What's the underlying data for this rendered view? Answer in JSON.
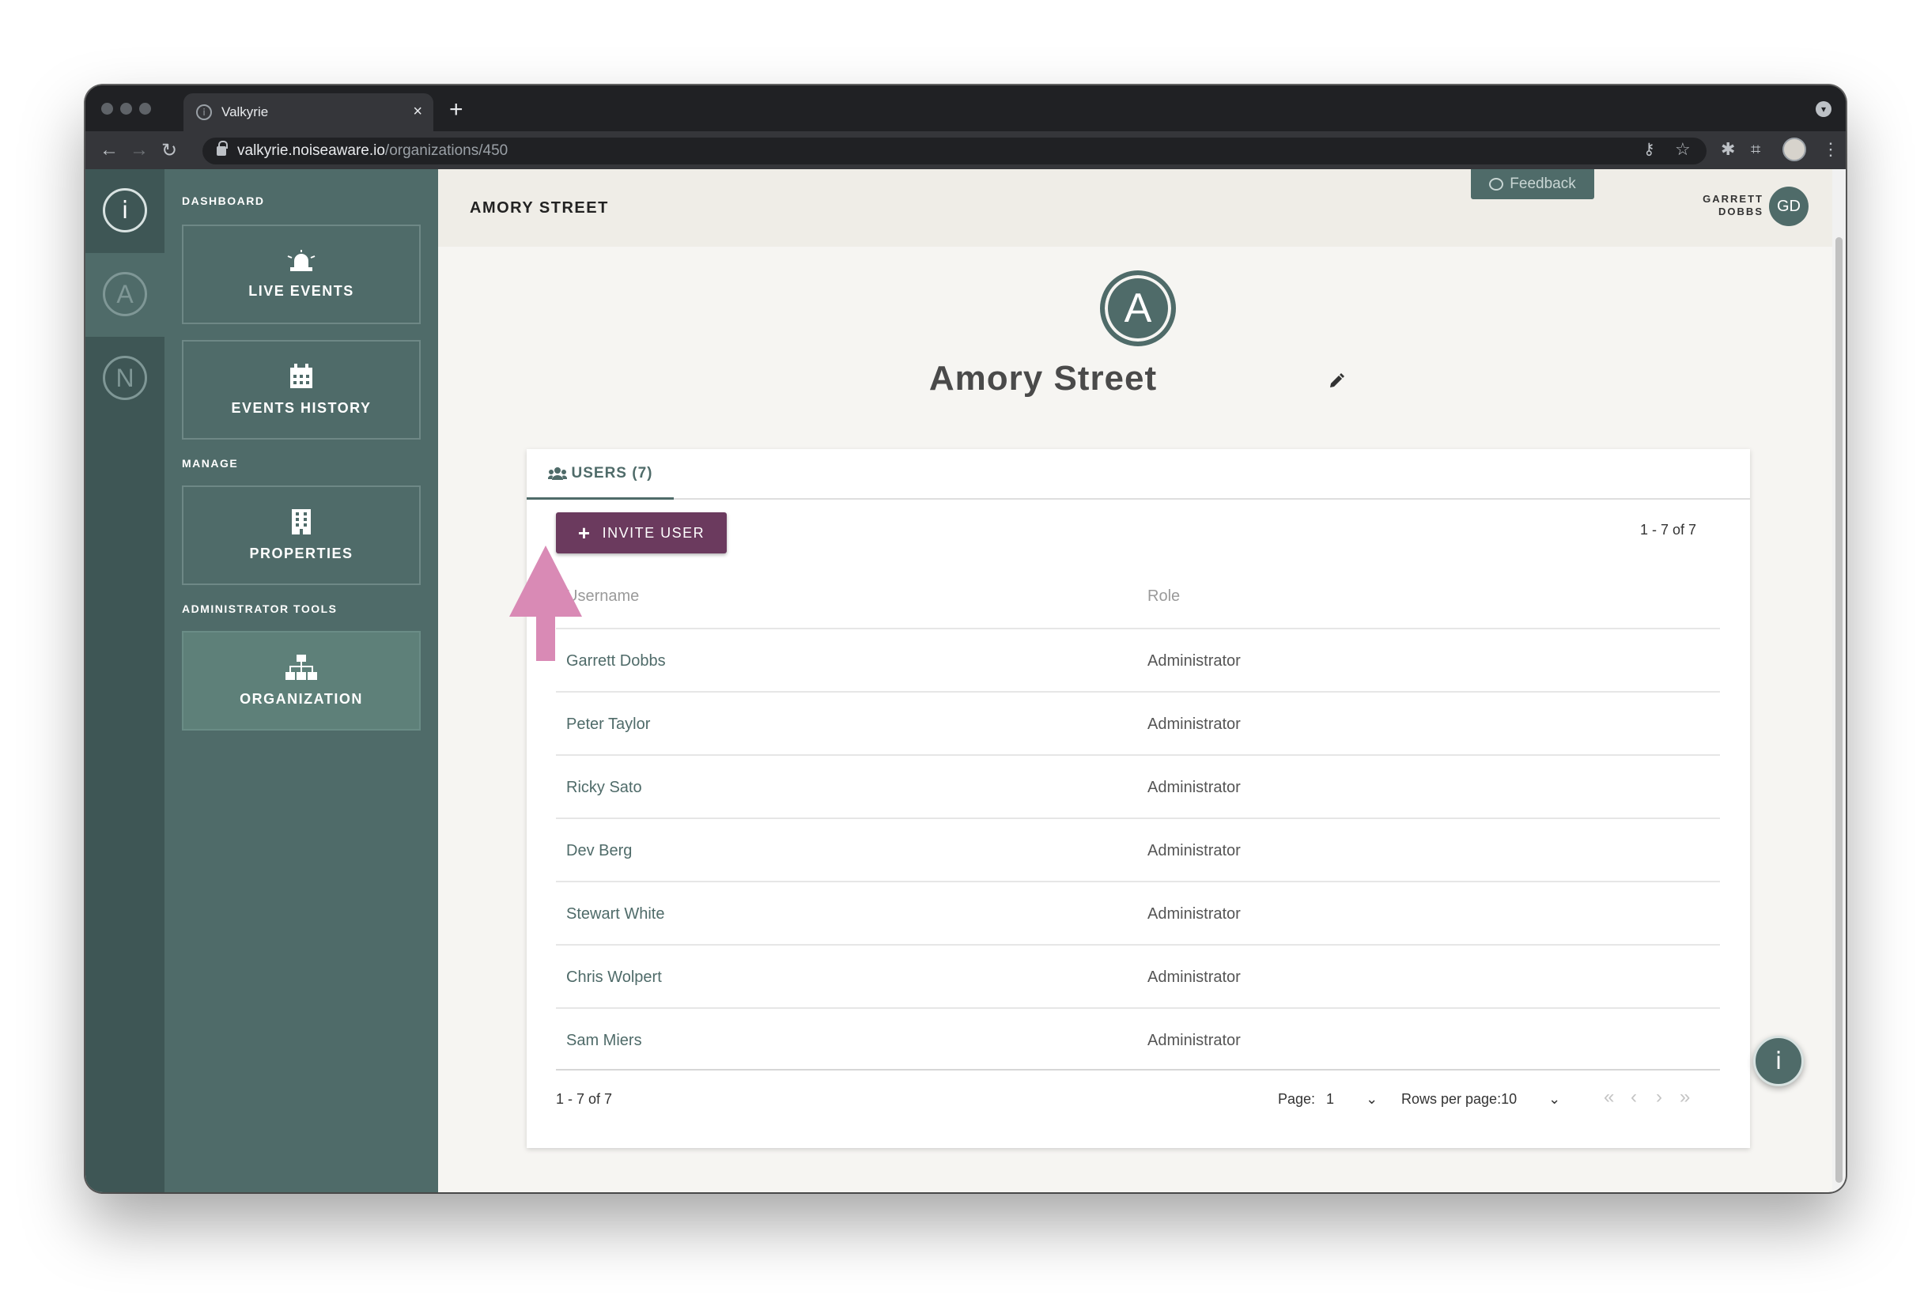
{
  "browser": {
    "tab_title": "Valkyrie",
    "tab_close": "×",
    "new_tab": "+",
    "url_host": "valkyrie.noiseaware.io",
    "url_path": "/organizations/450"
  },
  "rail": {
    "orgs": [
      "A",
      "N"
    ]
  },
  "sidebar": {
    "dashboard_label": "DASHBOARD",
    "live_events": "LIVE EVENTS",
    "events_history": "EVENTS HISTORY",
    "manage_label": "MANAGE",
    "properties": "PROPERTIES",
    "admin_label": "ADMINISTRATOR TOOLS",
    "organization": "ORGANIZATION"
  },
  "header": {
    "title": "AMORY STREET",
    "feedback": "Feedback",
    "user_first": "GARRETT",
    "user_last": "DOBBS",
    "user_initials": "GD"
  },
  "org": {
    "initial": "A",
    "name": "Amory Street"
  },
  "users_tab": {
    "label": "USERS (7)",
    "invite_button": "INVITE USER",
    "count_top": "1 - 7 of 7",
    "columns": {
      "username": "Username",
      "role": "Role"
    },
    "rows": [
      {
        "user": "Garrett Dobbs",
        "role": "Administrator"
      },
      {
        "user": "Peter Taylor",
        "role": "Administrator"
      },
      {
        "user": "Ricky Sato",
        "role": "Administrator"
      },
      {
        "user": "Dev Berg",
        "role": "Administrator"
      },
      {
        "user": "Stewart White",
        "role": "Administrator"
      },
      {
        "user": "Chris Wolpert",
        "role": "Administrator"
      },
      {
        "user": "Sam Miers",
        "role": "Administrator"
      }
    ],
    "footer_count": "1 - 7 of 7",
    "page_label": "Page:",
    "page_value": "1",
    "rows_per_page_label": "Rows per page:",
    "rows_per_page_value": "10"
  },
  "colors": {
    "sidebar": "#4f6b69",
    "rail": "#3e5655",
    "invite_button": "#6b3a5e",
    "pointer_arrow": "#d98ab5"
  },
  "icons": [
    "siren-icon",
    "calendar-icon",
    "building-icon",
    "org-chart-icon",
    "users-icon",
    "pencil-icon",
    "plus-icon",
    "chevron-down-icon",
    "first-page-icon",
    "prev-page-icon",
    "next-page-icon",
    "last-page-icon",
    "logo-icon",
    "feedback-icon"
  ]
}
